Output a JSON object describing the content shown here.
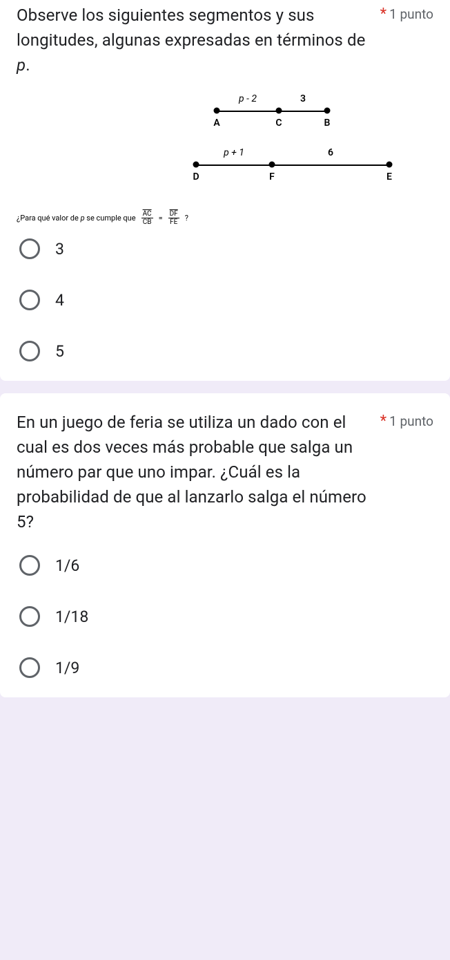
{
  "q1": {
    "text": "Observe los siguientes segmentos y sus longitudes, algunas expresadas en términos de ",
    "text_var": "p",
    "text_end": ".",
    "points": "1 punto",
    "diagram": {
      "seg1": {
        "label_top1": "p - 2",
        "label_top2": "3",
        "A": "A",
        "C": "C",
        "B": "B"
      },
      "seg2": {
        "label_top1": "p + 1",
        "label_top2": "6",
        "D": "D",
        "F": "F",
        "E": "E"
      }
    },
    "equation": {
      "prefix": "¿Para qué valor de ",
      "var": "p",
      "mid": " se cumple que ",
      "num1": "AC",
      "den1": "CB",
      "eq": "=",
      "num2": "DF",
      "den2": "FE",
      "suffix": "?"
    },
    "options": [
      "3",
      "4",
      "5"
    ]
  },
  "q2": {
    "text": "En un juego de feria se utiliza un dado con el cual es dos veces más probable que salga un número par que uno impar. ¿Cuál es la probabilidad de que al lanzarlo salga el número 5?",
    "points": "1 punto",
    "options": [
      "1/6",
      "1/18",
      "1/9"
    ]
  }
}
